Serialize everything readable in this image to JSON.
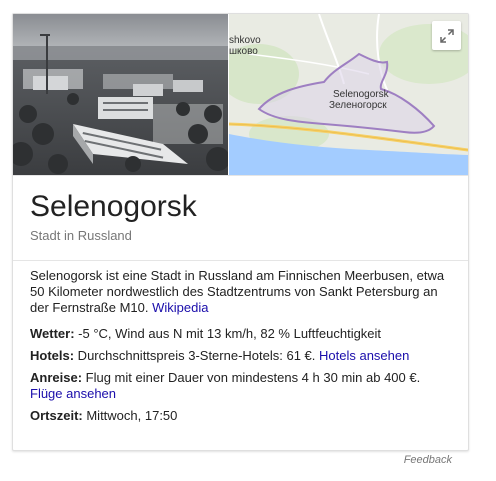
{
  "card": {
    "title": "Selenogorsk",
    "subtitle": "Stadt in Russland"
  },
  "map": {
    "label_top_line1": "shkovo",
    "label_top_line2": "шково",
    "city_label_latin": "Selenogorsk",
    "city_label_cyrillic": "Зеленогорск",
    "expand_icon": "expand-arrows-icon"
  },
  "description": {
    "text": "Selenogorsk ist eine Stadt in Russland am Finnischen Meerbusen, etwa 50 Kilometer nordwestlich des Stadtzentrums von Sankt Petersburg an der Fernstraße M10. ",
    "source_link": "Wikipedia"
  },
  "facts": {
    "weather": {
      "label": "Wetter:",
      "value": " -5 °C, Wind aus N mit 13 km/h, 82 % Luftfeuchtigkeit"
    },
    "hotels": {
      "label": "Hotels:",
      "value": " Durchschnittspreis 3-Sterne-Hotels: 61 €. ",
      "link": "Hotels ansehen"
    },
    "travel": {
      "label": "Anreise:",
      "value": " Flug mit einer Dauer von mindestens 4 h 30 min ab 400 €.",
      "link": "Flüge ansehen"
    },
    "local_time": {
      "label": "Ortszeit:",
      "value": " Mittwoch, 17:50"
    }
  },
  "footer": {
    "feedback": "Feedback"
  },
  "colors": {
    "link": "#1a0dab",
    "water": "#a3ccff",
    "city_outline": "#9e7fc2"
  }
}
